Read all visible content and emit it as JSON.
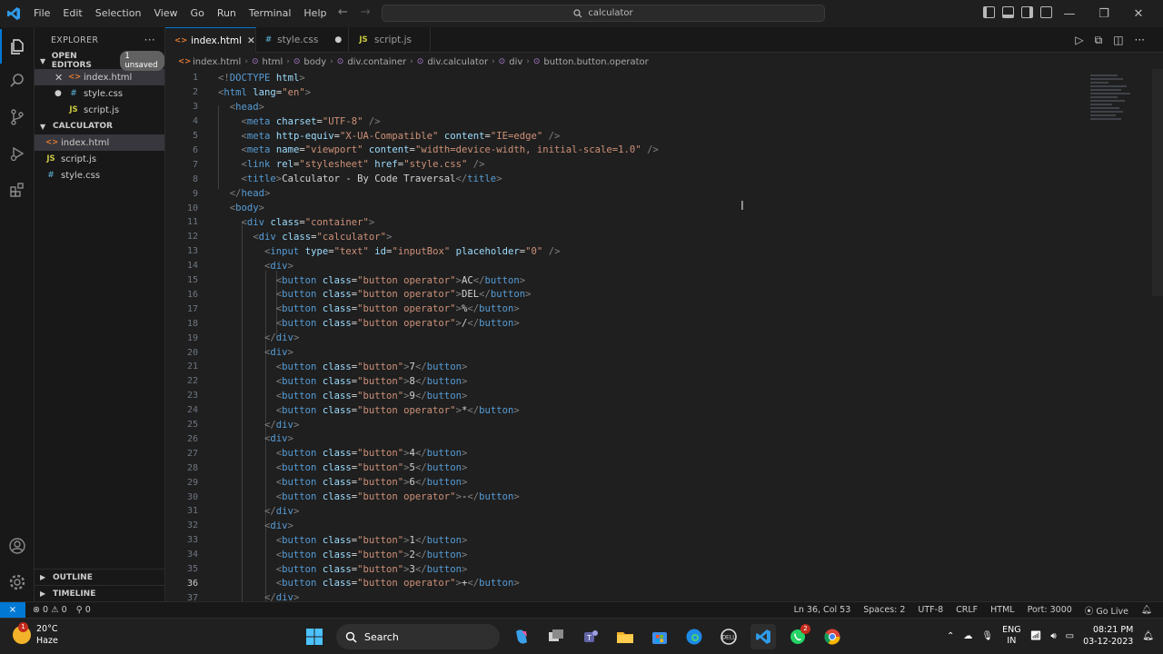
{
  "window": {
    "menu": [
      "File",
      "Edit",
      "Selection",
      "View",
      "Go",
      "Run",
      "Terminal",
      "Help"
    ],
    "search_text": "calculator",
    "controls": [
      "—",
      "❐",
      "✕"
    ]
  },
  "sidebar": {
    "title": "EXPLORER",
    "more": "···",
    "open_editors": {
      "label": "OPEN EDITORS",
      "badge": "1 unsaved",
      "items": [
        {
          "type": "<>",
          "name": "index.html"
        },
        {
          "type": "#",
          "name": "style.css"
        },
        {
          "type": "JS",
          "name": "script.js"
        }
      ]
    },
    "folder": {
      "label": "CALCULATOR",
      "items": [
        {
          "type": "<>",
          "name": "index.html"
        },
        {
          "type": "JS",
          "name": "script.js"
        },
        {
          "type": "#",
          "name": "style.css"
        }
      ]
    },
    "outline": "OUTLINE",
    "timeline": "TIMELINE"
  },
  "tabs": [
    {
      "type": "<>",
      "name": "index.html",
      "marker": "✕"
    },
    {
      "type": "#",
      "name": "style.css",
      "marker": "●"
    },
    {
      "type": "JS",
      "name": "script.js",
      "marker": ""
    }
  ],
  "breadcrumbs": [
    "index.html",
    "html",
    "body",
    "div.container",
    "div.calculator",
    "div",
    "button.button.operator"
  ],
  "editor": {
    "lines": [
      {
        "n": "1",
        "code": "<!DOCTYPE html>"
      },
      {
        "n": "2",
        "code": "<html lang=\"en\">"
      },
      {
        "n": "3",
        "code": "  <head>"
      },
      {
        "n": "4",
        "code": "    <meta charset=\"UTF-8\" />"
      },
      {
        "n": "5",
        "code": "    <meta http-equiv=\"X-UA-Compatible\" content=\"IE=edge\" />"
      },
      {
        "n": "6",
        "code": "    <meta name=\"viewport\" content=\"width=device-width, initial-scale=1.0\" />"
      },
      {
        "n": "7",
        "code": "    <link rel=\"stylesheet\" href=\"style.css\" />"
      },
      {
        "n": "8",
        "code": "    <title>Calculator - By Code Traversal</title>"
      },
      {
        "n": "9",
        "code": "  </head>"
      },
      {
        "n": "10",
        "code": "  <body>"
      },
      {
        "n": "11",
        "code": "    <div class=\"container\">"
      },
      {
        "n": "12",
        "code": "      <div class=\"calculator\">"
      },
      {
        "n": "13",
        "code": "        <input type=\"text\" id=\"inputBox\" placeholder=\"0\" />"
      },
      {
        "n": "14",
        "code": "        <div>"
      },
      {
        "n": "15",
        "code": "          <button class=\"button operator\">AC</button>"
      },
      {
        "n": "16",
        "code": "          <button class=\"button operator\">DEL</button>"
      },
      {
        "n": "17",
        "code": "          <button class=\"button operator\">%</button>"
      },
      {
        "n": "18",
        "code": "          <button class=\"button operator\">/</button>"
      },
      {
        "n": "19",
        "code": "        </div>"
      },
      {
        "n": "20",
        "code": "        <div>"
      },
      {
        "n": "21",
        "code": "          <button class=\"button\">7</button>"
      },
      {
        "n": "22",
        "code": "          <button class=\"button\">8</button>"
      },
      {
        "n": "23",
        "code": "          <button class=\"button\">9</button>"
      },
      {
        "n": "24",
        "code": "          <button class=\"button operator\">*</button>"
      },
      {
        "n": "25",
        "code": "        </div>"
      },
      {
        "n": "26",
        "code": "        <div>"
      },
      {
        "n": "27",
        "code": "          <button class=\"button\">4</button>"
      },
      {
        "n": "28",
        "code": "          <button class=\"button\">5</button>"
      },
      {
        "n": "29",
        "code": "          <button class=\"button\">6</button>"
      },
      {
        "n": "30",
        "code": "          <button class=\"button operator\">-</button>"
      },
      {
        "n": "31",
        "code": "        </div>"
      },
      {
        "n": "32",
        "code": "        <div>"
      },
      {
        "n": "33",
        "code": "          <button class=\"button\">1</button>"
      },
      {
        "n": "34",
        "code": "          <button class=\"button\">2</button>"
      },
      {
        "n": "35",
        "code": "          <button class=\"button\">3</button>"
      },
      {
        "n": "36",
        "code": "          <button class=\"button operator\">+</button>"
      },
      {
        "n": "37",
        "code": "        </div>"
      }
    ],
    "current_line": "36"
  },
  "status": {
    "errors": "0",
    "warnings": "0",
    "ports": "0",
    "position": "Ln 36, Col 53",
    "spaces": "Spaces: 2",
    "encoding": "UTF-8",
    "eol": "CRLF",
    "language": "HTML",
    "port": "Port: 3000",
    "golive": "Go Live"
  },
  "taskbar": {
    "temp": "20°C",
    "condition": "Haze",
    "weather_badge": "1",
    "search": "Search",
    "lang1": "ENG",
    "lang2": "IN",
    "time": "08:21 PM",
    "date": "03-12-2023",
    "whatsapp_badge": "2"
  },
  "colors": {
    "accent": "#0078d4",
    "tag": "#569cd6",
    "attr": "#9cdcfe",
    "string": "#ce9178"
  }
}
